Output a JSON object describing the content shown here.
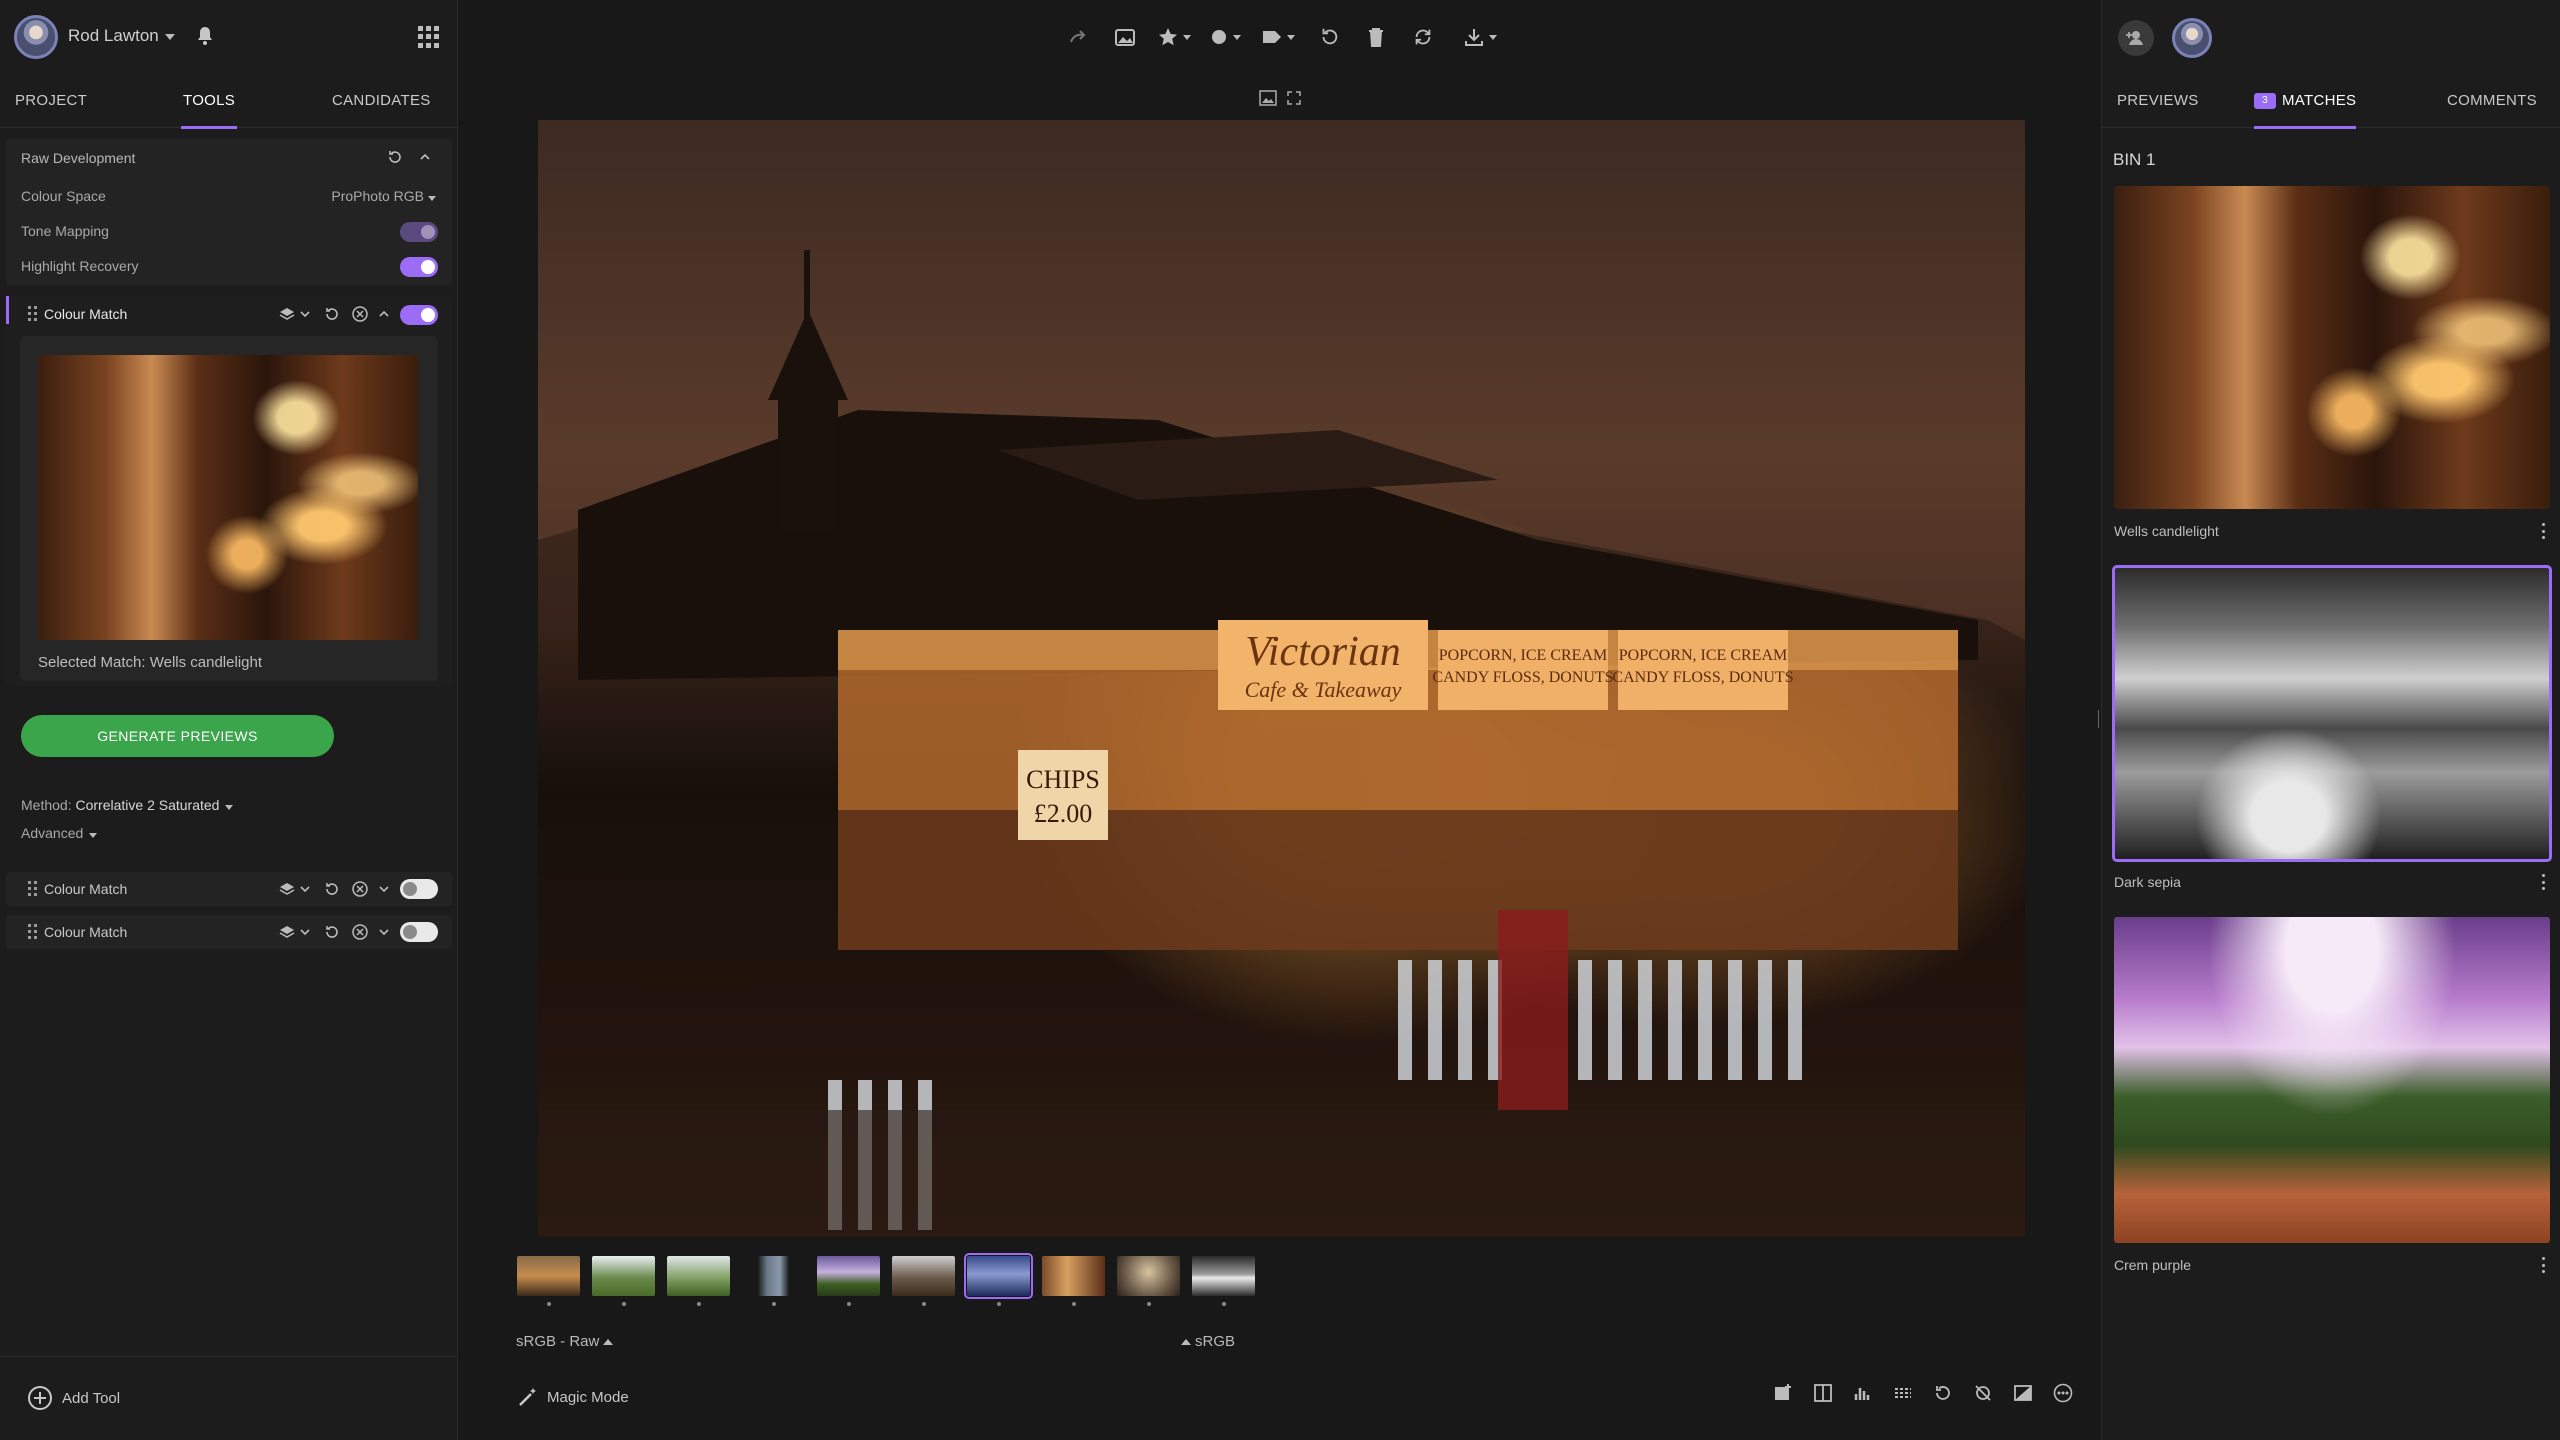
{
  "user": {
    "name": "Rod Lawton"
  },
  "left_tabs": [
    {
      "label": "PROJECT"
    },
    {
      "label": "TOOLS"
    },
    {
      "label": "CANDIDATES"
    }
  ],
  "raw_dev": {
    "title": "Raw Development",
    "colour_space_label": "Colour Space",
    "colour_space_value": "ProPhoto RGB",
    "tone_mapping_label": "Tone Mapping",
    "highlight_recovery_label": "Highlight Recovery"
  },
  "colour_match_active": {
    "title": "Colour Match",
    "selected_match": "Selected Match: Wells candlelight",
    "generate_label": "GENERATE PREVIEWS",
    "method_label": "Method:",
    "method_value": "Correlative 2 Saturated",
    "advanced_label": "Advanced"
  },
  "colour_match_2": {
    "title": "Colour Match"
  },
  "colour_match_3": {
    "title": "Colour Match"
  },
  "add_tool_label": "Add Tool",
  "center": {
    "colourspace_left": "sRGB - Raw",
    "colourspace_right": "sRGB",
    "magic_mode_label": "Magic Mode",
    "signage": {
      "victorian": "Victorian",
      "cafe": "Cafe & Takeaway",
      "popcorn1": "POPCORN, ICE CREAM",
      "popcorn1b": "CANDY FLOSS, DONUTS",
      "popcorn2": "POPCORN, ICE CREAM",
      "popcorn2b": "CANDY FLOSS, DONUTS",
      "chips": "CHIPS",
      "price": "£2.00"
    }
  },
  "right_tabs": [
    {
      "label": "PREVIEWS"
    },
    {
      "label": "MATCHES",
      "badge": "3"
    },
    {
      "label": "COMMENTS"
    }
  ],
  "bin": {
    "title": "BIN 1",
    "matches": [
      {
        "caption": "Wells candlelight"
      },
      {
        "caption": "Dark sepia"
      },
      {
        "caption": "Crem purple"
      }
    ]
  },
  "colors": {
    "accent": "#9b6cf5",
    "generate": "#3aa54a",
    "background": "#181818",
    "panel": "#1c1c1c"
  }
}
